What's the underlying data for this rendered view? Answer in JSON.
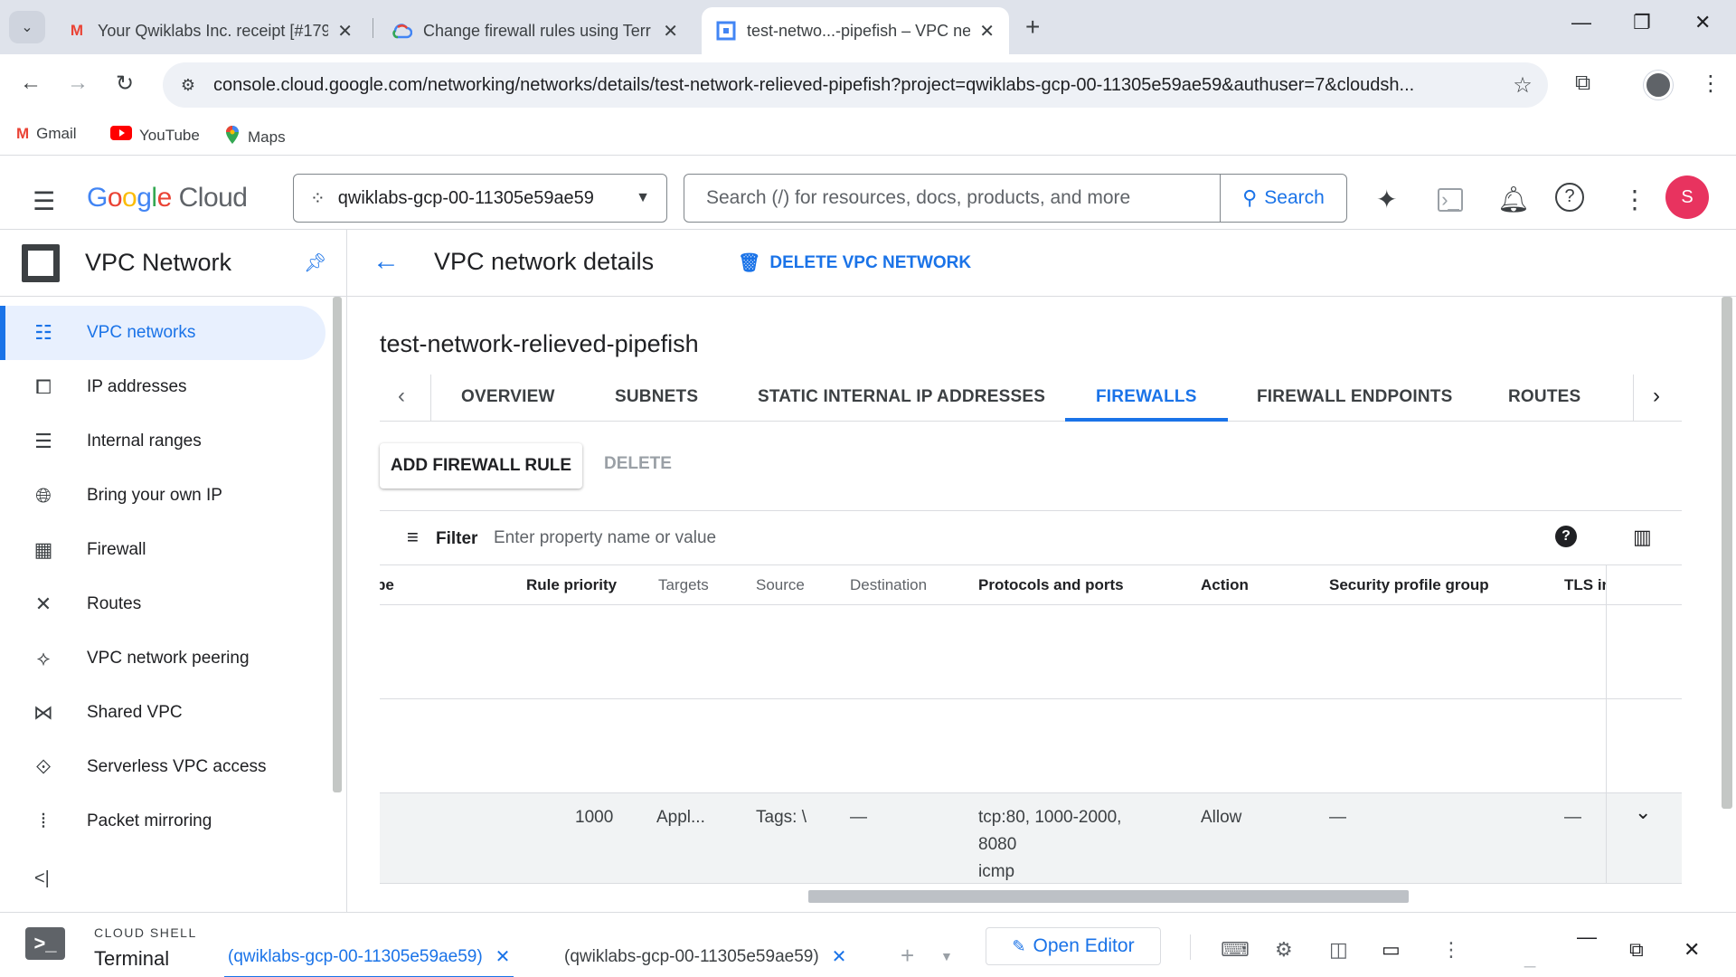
{
  "browser": {
    "tabs": [
      {
        "title": "Your Qwiklabs Inc. receipt [#179",
        "favicon": "gmail-icon",
        "active": false
      },
      {
        "title": "Change firewall rules using Terr",
        "favicon": "google-cloud-icon",
        "active": false
      },
      {
        "title": "test-netwo...-pipefish – VPC net",
        "favicon": "vpc-network-icon",
        "active": true
      }
    ],
    "url": "console.cloud.google.com/networking/networks/details/test-network-relieved-pipefish?project=qwiklabs-gcp-00-11305e59ae59&authuser=7&cloudsh...",
    "bookmarks": [
      {
        "label": "Gmail",
        "icon": "gmail-icon"
      },
      {
        "label": "YouTube",
        "icon": "youtube-icon"
      },
      {
        "label": "Maps",
        "icon": "maps-icon"
      }
    ]
  },
  "header": {
    "logo_google": "Google",
    "logo_cloud": "Cloud",
    "project": "qwiklabs-gcp-00-11305e59ae59",
    "search_placeholder": "Search (/) for resources, docs, products, and more",
    "search_button": "Search",
    "avatar_initial": "S"
  },
  "leftnav": {
    "product_title": "VPC Network",
    "items": [
      {
        "label": "VPC networks",
        "icon": "vpc-networks-icon",
        "active": true
      },
      {
        "label": "IP addresses",
        "icon": "ip-addresses-icon"
      },
      {
        "label": "Internal ranges",
        "icon": "internal-ranges-icon"
      },
      {
        "label": "Bring your own IP",
        "icon": "globe-icon"
      },
      {
        "label": "Firewall",
        "icon": "firewall-icon"
      },
      {
        "label": "Routes",
        "icon": "routes-icon"
      },
      {
        "label": "VPC network peering",
        "icon": "peering-icon"
      },
      {
        "label": "Shared VPC",
        "icon": "shared-vpc-icon"
      },
      {
        "label": "Serverless VPC access",
        "icon": "serverless-icon"
      },
      {
        "label": "Packet mirroring",
        "icon": "packet-mirroring-icon"
      }
    ]
  },
  "main": {
    "page_title": "VPC network details",
    "delete_network_label": "DELETE VPC NETWORK",
    "network_name": "test-network-relieved-pipefish",
    "tabs": [
      {
        "label": "OVERVIEW"
      },
      {
        "label": "SUBNETS"
      },
      {
        "label": "STATIC INTERNAL IP ADDRESSES"
      },
      {
        "label": "FIREWALLS",
        "active": true
      },
      {
        "label": "FIREWALL ENDPOINTS"
      },
      {
        "label": "ROUTES"
      }
    ],
    "add_rule_label": "ADD FIREWALL RULE",
    "delete_label": "DELETE",
    "filter_label": "Filter",
    "filter_placeholder": "Enter property name or value",
    "columns": [
      "pe",
      "Rule priority",
      "Targets",
      "Source",
      "Destination",
      "Protocols and ports",
      "Action",
      "Security profile group",
      "TLS in"
    ],
    "rows": [
      {
        "priority": "",
        "targets": "",
        "source": "",
        "destination": "",
        "protocols": [],
        "action": "",
        "security": "",
        "tls": ""
      },
      {
        "priority": "",
        "targets": "",
        "source": "",
        "destination": "",
        "protocols": [],
        "action": "",
        "security": "",
        "tls": ""
      },
      {
        "priority": "1000",
        "targets": "Appl...",
        "source": "Tags: \\",
        "destination": "—",
        "protocols": [
          "tcp:80, 1000-2000,",
          "8080",
          "icmp"
        ],
        "action": "Allow",
        "security": "—",
        "tls": "—"
      }
    ]
  },
  "cloud_shell": {
    "small_label": "CLOUD SHELL",
    "big_label": "Terminal",
    "tabs": [
      {
        "label": "(qwiklabs-gcp-00-11305e59ae59)",
        "active": true
      },
      {
        "label": "(qwiklabs-gcp-00-11305e59ae59)",
        "active": false
      }
    ],
    "open_editor_label": "Open Editor"
  },
  "colors": {
    "accent": "#1a73e8",
    "avatar": "#e8335f",
    "active_nav_bg": "#e8f0fe"
  }
}
